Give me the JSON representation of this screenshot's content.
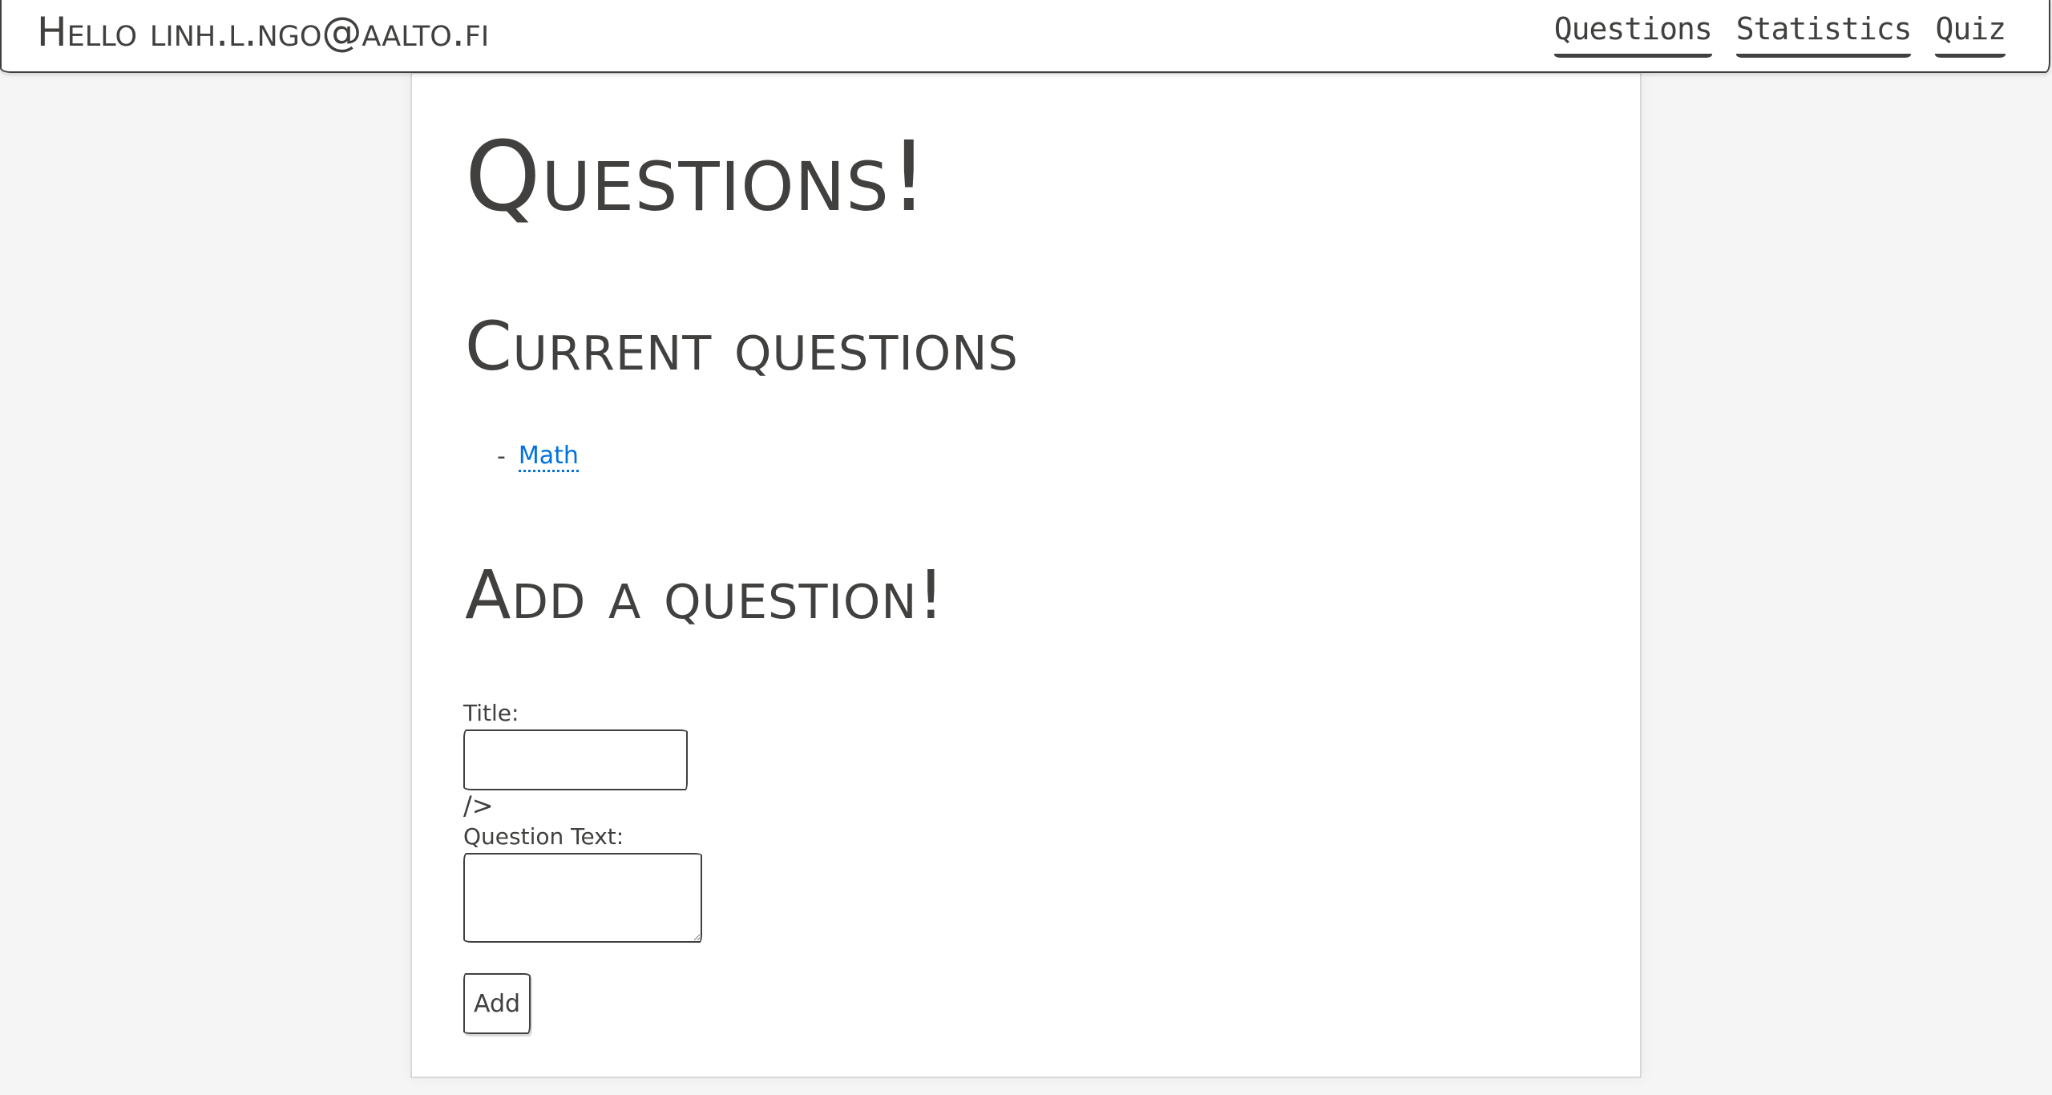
{
  "navbar": {
    "brand": "Hello linh.l.ngo@aalto.fi",
    "links": [
      {
        "label": "Questions"
      },
      {
        "label": "Statistics"
      },
      {
        "label": "Quiz"
      }
    ]
  },
  "main": {
    "title": "Questions!",
    "current_heading": "Current questions",
    "questions": [
      {
        "bullet": "-",
        "title": "Math"
      }
    ],
    "add_heading": "Add a question!",
    "form": {
      "title_label": "Title:",
      "title_value": "",
      "stray_text": "/>",
      "question_text_label": "Question Text:",
      "question_text_value": "",
      "submit_label": "Add"
    }
  },
  "colors": {
    "text": "#41403e",
    "link": "#0071de",
    "background": "#f5f5f5",
    "card": "#ffffff"
  }
}
